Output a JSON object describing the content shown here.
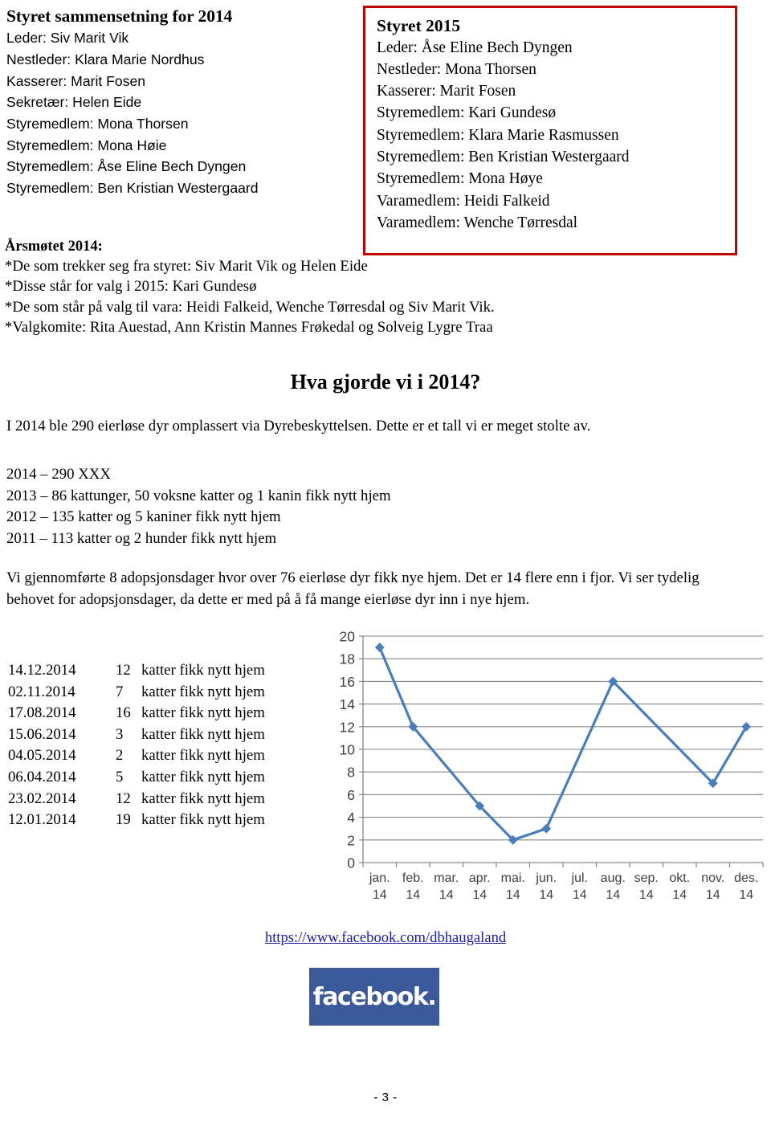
{
  "board_2014": {
    "heading": "Styret sammensetning for 2014",
    "members": [
      "Leder: Siv Marit Vik",
      "Nestleder: Klara Marie Nordhus",
      "Kasserer: Marit Fosen",
      "Sekretær: Helen Eide",
      "Styremedlem: Mona Thorsen",
      "Styremedlem: Mona Høie",
      "Styremedlem: Åse Eline Bech Dyngen",
      "Styremedlem: Ben Kristian Westergaard"
    ]
  },
  "board_2015": {
    "heading": "Styret 2015",
    "border_color": "#c00000",
    "members": [
      "Leder:  Åse Eline Bech Dyngen",
      "Nestleder: Mona Thorsen",
      "Kasserer: Marit Fosen",
      "Styremedlem: Kari Gundesø",
      "Styremedlem: Klara Marie Rasmussen",
      "Styremedlem: Ben Kristian Westergaard",
      "Styremedlem: Mona Høye",
      "Varamedlem: Heidi Falkeid",
      "Varamedlem: Wenche Tørresdal"
    ]
  },
  "annual_meeting": {
    "heading": "Årsmøtet 2014:",
    "lines": [
      "*De som trekker seg fra styret: Siv Marit Vik og Helen Eide",
      "*Disse står for valg i 2015: Kari Gundesø",
      "*De som står på valg til vara: Heidi Falkeid, Wenche Tørresdal og Siv Marit Vik.",
      "*Valgkomite: Rita Auestad, Ann Kristin Mannes Frøkedal og Solveig Lygre Traa"
    ]
  },
  "section": {
    "title": "Hva gjorde vi i 2014?",
    "intro": "I 2014 ble 290 eierløse dyr omplassert via Dyrebeskyttelsen. Dette er et tall vi er meget stolte av.",
    "year_summary": [
      "2014 – 290 XXX",
      "2013 – 86 kattunger, 50 voksne katter og 1 kanin fikk nytt hjem",
      "2012 – 135 katter og 5 kaniner fikk nytt hjem",
      "2011 – 113 katter og 2 hunder fikk nytt hjem"
    ],
    "adoption_paragraph": "Vi gjennomførte 8 adopsjonsdager hvor over 76 eierløse dyr fikk nye hjem. Det er 14 flere enn i fjor. Vi ser tydelig behovet for adopsjonsdager, da dette er med på å få mange eierløse dyr inn i nye hjem."
  },
  "adoption_days": {
    "rows": [
      {
        "date": "14.12.2014",
        "count": "12",
        "text": "katter fikk nytt hjem"
      },
      {
        "date": "02.11.2014",
        "count": "7",
        "text": "katter fikk nytt hjem"
      },
      {
        "date": "17.08.2014",
        "count": "16",
        "text": "katter fikk nytt hjem"
      },
      {
        "date": "15.06.2014",
        "count": "3",
        "text": "katter fikk nytt hjem"
      },
      {
        "date": "04.05.2014",
        "count": "2",
        "text": "katter fikk nytt hjem"
      },
      {
        "date": "06.04.2014",
        "count": "5",
        "text": "katter fikk nytt hjem"
      },
      {
        "date": "23.02.2014",
        "count": "12",
        "text": "katter fikk nytt hjem"
      },
      {
        "date": "12.01.2014",
        "count": "19",
        "text": "katter fikk nytt hjem"
      }
    ]
  },
  "chart_data": {
    "type": "line",
    "title": "",
    "xlabel": "",
    "ylabel": "",
    "ylim": [
      0,
      20
    ],
    "yticks": [
      0,
      2,
      4,
      6,
      8,
      10,
      12,
      14,
      16,
      18,
      20
    ],
    "grid": true,
    "legend": "none",
    "line_color": "#4a7ebb",
    "marker": "diamond",
    "categories": [
      "jan. 14",
      "feb. 14",
      "mar. 14",
      "apr. 14",
      "mai. 14",
      "jun. 14",
      "jul. 14",
      "aug. 14",
      "sep. 14",
      "okt. 14",
      "nov. 14",
      "des. 14"
    ],
    "category_lines": [
      [
        "jan.",
        "14"
      ],
      [
        "feb.",
        "14"
      ],
      [
        "mar.",
        "14"
      ],
      [
        "apr.",
        "14"
      ],
      [
        "mai.",
        "14"
      ],
      [
        "jun.",
        "14"
      ],
      [
        "jul.",
        "14"
      ],
      [
        "aug.",
        "14"
      ],
      [
        "sep.",
        "14"
      ],
      [
        "okt.",
        "14"
      ],
      [
        "nov.",
        "14"
      ],
      [
        "des.",
        "14"
      ]
    ],
    "series": [
      {
        "name": "Katter fikk nytt hjem",
        "values": [
          19,
          12,
          null,
          5,
          2,
          3,
          null,
          16,
          null,
          null,
          7,
          12
        ]
      }
    ]
  },
  "facebook": {
    "url_text": "https://www.facebook.com/dbhaugaland",
    "logo_text": "facebook.",
    "logo_color": "#3b5998"
  },
  "footer": {
    "page_number": "- 3 -"
  }
}
